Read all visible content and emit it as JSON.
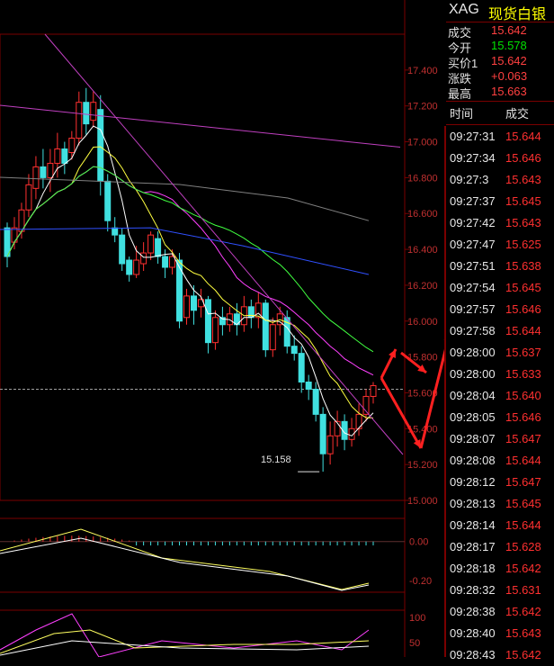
{
  "header": {
    "symbol": "XAG",
    "name": "现货白银"
  },
  "quote": [
    {
      "label": "成交",
      "value": "15.642",
      "color": "red"
    },
    {
      "label": "今开",
      "value": "15.578",
      "color": "green"
    },
    {
      "label": "买价1",
      "value": "15.642",
      "color": "red"
    },
    {
      "label": "涨跌",
      "value": "+0.063",
      "color": "red"
    },
    {
      "label": "最高",
      "value": "15.663",
      "color": "red"
    }
  ],
  "ticks_header": {
    "time": "时间",
    "price": "成交"
  },
  "ticks": [
    {
      "time": "09:27:31",
      "price": "15.644"
    },
    {
      "time": "09:27:34",
      "price": "15.646"
    },
    {
      "time": "09:27:3",
      "price": "15.643"
    },
    {
      "time": "09:27:37",
      "price": "15.645"
    },
    {
      "time": "09:27:42",
      "price": "15.643"
    },
    {
      "time": "09:27:47",
      "price": "15.625"
    },
    {
      "time": "09:27:51",
      "price": "15.638"
    },
    {
      "time": "09:27:54",
      "price": "15.645"
    },
    {
      "time": "09:27:57",
      "price": "15.646"
    },
    {
      "time": "09:27:58",
      "price": "15.644"
    },
    {
      "time": "09:28:00",
      "price": "15.637"
    },
    {
      "time": "09:28:00",
      "price": "15.633"
    },
    {
      "time": "09:28:04",
      "price": "15.640"
    },
    {
      "time": "09:28:05",
      "price": "15.646"
    },
    {
      "time": "09:28:07",
      "price": "15.647"
    },
    {
      "time": "09:28:08",
      "price": "15.644"
    },
    {
      "time": "09:28:12",
      "price": "15.647"
    },
    {
      "time": "09:28:13",
      "price": "15.645"
    },
    {
      "time": "09:28:14",
      "price": "15.644"
    },
    {
      "time": "09:28:17",
      "price": "15.628"
    },
    {
      "time": "09:28:18",
      "price": "15.642"
    },
    {
      "time": "09:28:32",
      "price": "15.631"
    },
    {
      "time": "09:28:38",
      "price": "15.642"
    },
    {
      "time": "09:28:40",
      "price": "15.643"
    },
    {
      "time": "09:28:43",
      "price": "15.642"
    }
  ],
  "chart_data": {
    "type": "candlestick",
    "ylim": [
      15.0,
      17.6
    ],
    "yticks": [
      "17.400",
      "17.200",
      "17.000",
      "16.800",
      "16.600",
      "16.400",
      "16.200",
      "16.000",
      "15.800",
      "15.600",
      "15.400",
      "15.200",
      "15.000"
    ],
    "low_annotation": "15.158",
    "reference_price": 15.62,
    "candles": [
      [
        16.52,
        16.36,
        16.3,
        16.55
      ],
      [
        16.44,
        16.52,
        16.4,
        16.58
      ],
      [
        16.5,
        16.62,
        16.46,
        16.66
      ],
      [
        16.62,
        16.76,
        16.58,
        16.82
      ],
      [
        16.74,
        16.86,
        16.68,
        16.92
      ],
      [
        16.86,
        16.8,
        16.74,
        16.96
      ],
      [
        16.8,
        16.88,
        16.72,
        16.96
      ],
      [
        16.88,
        16.96,
        16.8,
        17.05
      ],
      [
        16.96,
        16.88,
        16.82,
        17.0
      ],
      [
        16.94,
        17.02,
        16.9,
        17.06
      ],
      [
        17.02,
        17.22,
        16.98,
        17.28
      ],
      [
        17.22,
        17.1,
        17.04,
        17.3
      ],
      [
        17.12,
        17.22,
        17.08,
        17.28
      ],
      [
        17.18,
        16.78,
        16.7,
        17.26
      ],
      [
        16.78,
        16.56,
        16.5,
        16.82
      ],
      [
        16.52,
        16.48,
        16.44,
        16.58
      ],
      [
        16.48,
        16.32,
        16.28,
        16.52
      ],
      [
        16.34,
        16.26,
        16.22,
        16.36
      ],
      [
        16.26,
        16.34,
        16.24,
        16.42
      ],
      [
        16.32,
        16.38,
        16.28,
        16.44
      ],
      [
        16.38,
        16.48,
        16.34,
        16.5
      ],
      [
        16.46,
        16.36,
        16.32,
        16.5
      ],
      [
        16.36,
        16.3,
        16.24,
        16.4
      ],
      [
        16.3,
        16.36,
        16.26,
        16.4
      ],
      [
        16.34,
        16.0,
        15.96,
        16.38
      ],
      [
        16.02,
        16.14,
        15.98,
        16.18
      ],
      [
        16.14,
        16.06,
        15.98,
        16.2
      ],
      [
        16.08,
        16.12,
        16.02,
        16.18
      ],
      [
        16.12,
        15.88,
        15.82,
        16.14
      ],
      [
        15.88,
        16.02,
        15.84,
        16.06
      ],
      [
        16.02,
        15.98,
        15.92,
        16.08
      ],
      [
        15.98,
        16.04,
        15.94,
        16.08
      ],
      [
        16.04,
        15.98,
        15.92,
        16.1
      ],
      [
        15.98,
        16.08,
        15.94,
        16.14
      ],
      [
        16.08,
        16.02,
        15.96,
        16.12
      ],
      [
        16.02,
        16.1,
        15.96,
        16.16
      ],
      [
        16.1,
        15.84,
        15.8,
        16.12
      ],
      [
        15.84,
        15.98,
        15.8,
        16.02
      ],
      [
        15.98,
        16.04,
        15.92,
        16.08
      ],
      [
        16.02,
        15.86,
        15.82,
        16.06
      ],
      [
        15.86,
        15.82,
        15.78,
        15.92
      ],
      [
        15.82,
        15.66,
        15.6,
        15.86
      ],
      [
        15.66,
        15.62,
        15.56,
        15.7
      ],
      [
        15.62,
        15.48,
        15.44,
        15.66
      ],
      [
        15.48,
        15.26,
        15.16,
        15.52
      ],
      [
        15.26,
        15.36,
        15.2,
        15.44
      ],
      [
        15.36,
        15.44,
        15.3,
        15.5
      ],
      [
        15.44,
        15.34,
        15.28,
        15.48
      ],
      [
        15.34,
        15.4,
        15.3,
        15.46
      ],
      [
        15.4,
        15.48,
        15.36,
        15.54
      ],
      [
        15.48,
        15.58,
        15.44,
        15.62
      ],
      [
        15.58,
        15.64,
        15.54,
        15.66
      ]
    ],
    "macd_ylim": [
      -0.25,
      0.1
    ],
    "macd_yticks": [
      "0.00",
      "-0.20"
    ],
    "rsi_ylim": [
      30,
      110
    ],
    "rsi_yticks": [
      "100",
      "50"
    ]
  }
}
